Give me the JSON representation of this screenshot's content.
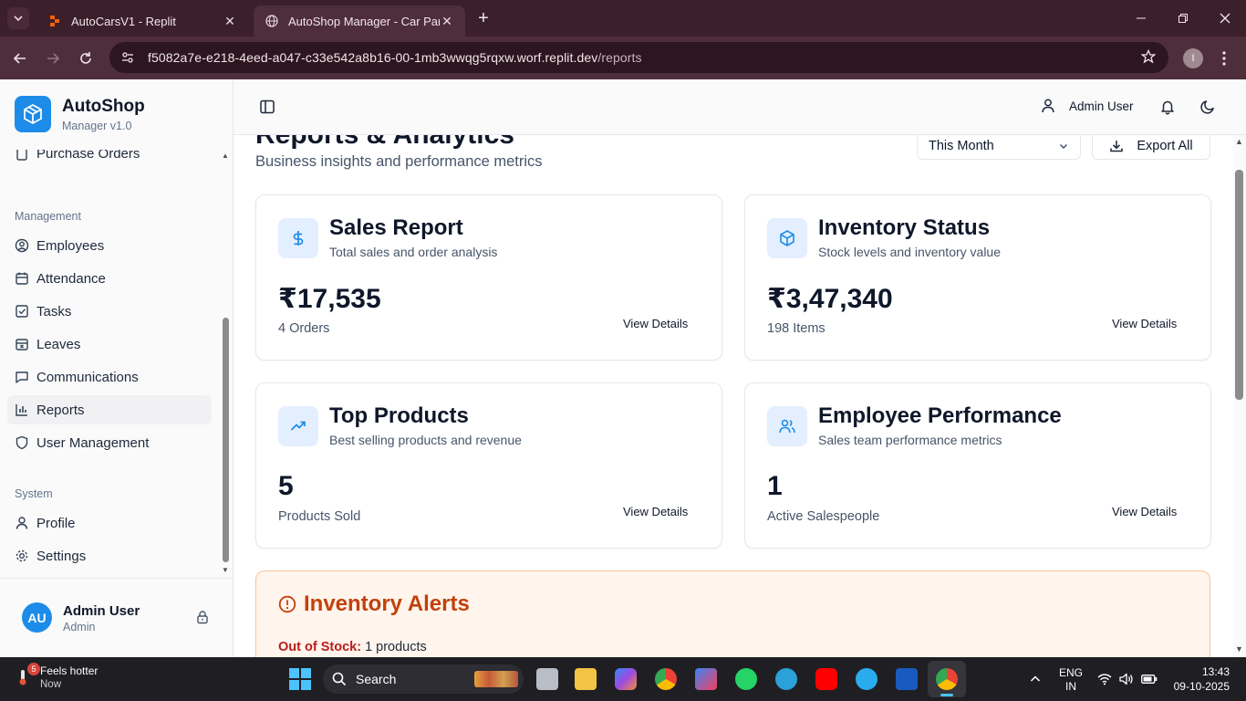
{
  "browser": {
    "tabs": [
      {
        "title": "AutoCarsV1 - Replit",
        "active": false
      },
      {
        "title": "AutoShop Manager - Car Parts",
        "active": true
      }
    ],
    "url_host": "f5082a7e-e218-4eed-a047-c33e542a8b16-00-1mb3wwqg5rqxw.worf.replit.dev",
    "url_path": "/reports",
    "profile_initial": "I"
  },
  "sidebar": {
    "brand_name": "AutoShop",
    "brand_version": "Manager v1.0",
    "top_item": "Purchase Orders",
    "group_management": "Management",
    "management_items": [
      "Employees",
      "Attendance",
      "Tasks",
      "Leaves",
      "Communications",
      "Reports",
      "User Management"
    ],
    "group_system": "System",
    "system_items": [
      "Profile",
      "Settings"
    ],
    "active_item": "Reports",
    "user": {
      "initials": "AU",
      "name": "Admin User",
      "role": "Admin"
    }
  },
  "header": {
    "user_name": "Admin User"
  },
  "main": {
    "title": "Reports & Analytics",
    "subtitle": "Business insights and performance metrics",
    "period": "This Month",
    "export_label": "Export All",
    "cards": [
      {
        "title": "Sales Report",
        "subtitle": "Total sales and order analysis",
        "value": "₹17,535",
        "label": "4 Orders",
        "link": "View Details"
      },
      {
        "title": "Inventory Status",
        "subtitle": "Stock levels and inventory value",
        "value": "₹3,47,340",
        "label": "198 Items",
        "link": "View Details"
      },
      {
        "title": "Top Products",
        "subtitle": "Best selling products and revenue",
        "value": "5",
        "label": "Products Sold",
        "link": "View Details"
      },
      {
        "title": "Employee Performance",
        "subtitle": "Sales team performance metrics",
        "value": "1",
        "label": "Active Salespeople",
        "link": "View Details"
      }
    ],
    "alerts": {
      "title": "Inventory Alerts",
      "out_of_stock_label": "Out of Stock:",
      "out_of_stock_value": "1 products"
    }
  },
  "taskbar": {
    "weather_title": "Feels hotter",
    "weather_sub": "Now",
    "weather_badge": "5",
    "search_label": "Search",
    "lang_line1": "ENG",
    "lang_line2": "IN",
    "time": "13:43",
    "date": "09-10-2025"
  },
  "colors": {
    "accent": "#1d8ce8",
    "chrome": "#4f2e3c",
    "alert_title": "#c2410c",
    "alert_label": "#b91c1c"
  }
}
